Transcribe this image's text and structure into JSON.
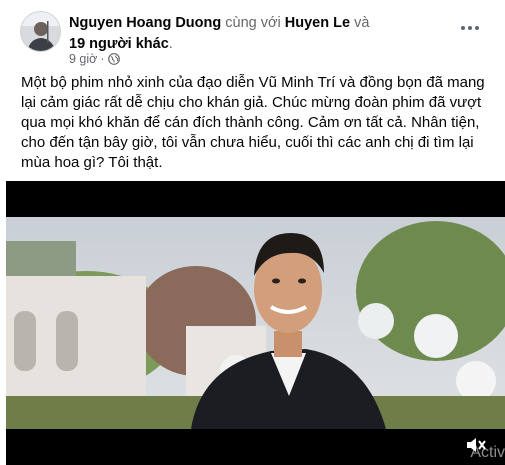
{
  "post": {
    "author": "Nguyen Hoang Duong",
    "with_text": "cùng với",
    "tagged": "Huyen Le",
    "and_text": "và",
    "others": "19 người khác",
    "time": "9 giờ",
    "body": "Một bộ phim nhỏ xinh của đạo diễn Vũ Minh Trí và đồng bọn đã mang lại cảm giác rất dễ chịu cho khán giả. Chúc mừng đoàn phim đã vượt qua mọi khó khăn để cán đích thành công. Cảm ơn tất cả. Nhân tiện, cho đến tận bây giờ, tôi vẫn chưa hiểu, cuối thì các anh chị đi tìm lại mùa hoa gì? Tôi thật."
  },
  "icons": {
    "privacy": "globe-icon",
    "more": "more-options-icon",
    "volume": "volume-icon"
  },
  "video": {
    "watermark": "Activ"
  },
  "colors": {
    "text": "#050505",
    "secondary": "#65676b",
    "video_bg": "#000000"
  }
}
